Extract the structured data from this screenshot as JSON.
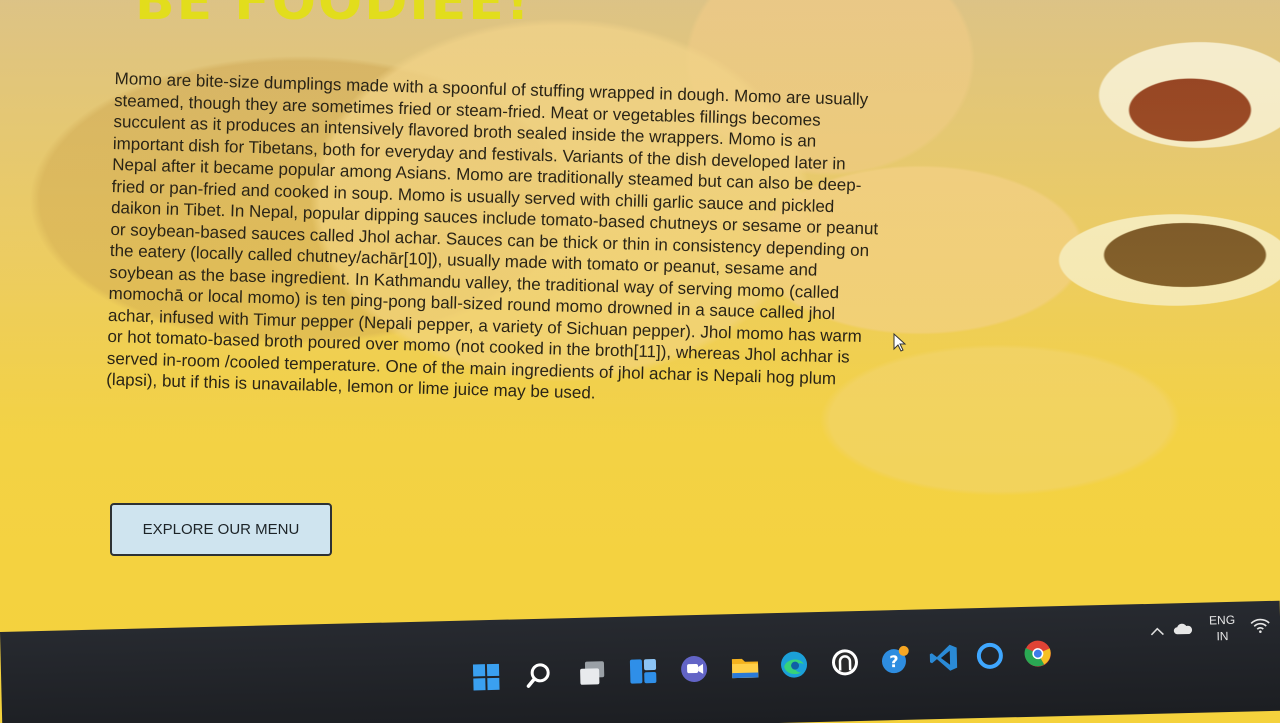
{
  "hero": {
    "title": "BE FOODIEE!",
    "description": "Momo are bite-size dumplings made with a spoonful of stuffing wrapped in dough. Momo are usually steamed, though they are sometimes fried or steam-fried. Meat or vegetables fillings becomes succulent as it produces an intensively flavored broth sealed inside the wrappers. Momo is an important dish for Tibetans, both for everyday and festivals. Variants of the dish developed later in Nepal after it became popular among Asians. Momo are traditionally steamed but can also be deep-fried or pan-fried and cooked in soup. Momo is usually served with chilli garlic sauce and pickled daikon in Tibet. In Nepal, popular dipping sauces include tomato-based chutneys or sesame or peanut or soybean-based sauces called Jhol achar. Sauces can be thick or thin in consistency depending on the eatery (locally called chutney/achār[10]), usually made with tomato or peanut, sesame and soybean as the base ingredient. In Kathmandu valley, the traditional way of serving momo (called momochā or local momo) is ten ping-pong ball-sized round momo drowned in a sauce called jhol achar, infused with Timur pepper (Nepali pepper, a variety of Sichuan pepper). Jhol momo has warm or hot tomato-based broth poured over momo (not cooked in the broth[11]), whereas Jhol achhar is served in-room /cooled temperature. One of the main ingredients of jhol achar is Nepali hog plum (lapsi), but if this is unavailable, lemon or lime juice may be used.",
    "button_label": "EXPLORE OUR MENU"
  },
  "social": [
    {
      "icon": "facebook-icon"
    },
    {
      "icon": "instagram-icon"
    },
    {
      "icon": "twitter-icon"
    }
  ],
  "taskbar": {
    "icons": [
      "windows-start-icon",
      "search-icon",
      "task-view-icon",
      "widgets-icon",
      "chat-icon",
      "file-explorer-icon",
      "edge-icon",
      "app-icon",
      "help-icon",
      "vscode-icon",
      "cortana-icon",
      "chrome-icon"
    ],
    "tray": {
      "language": "ENG",
      "region": "IN"
    }
  },
  "colors": {
    "title": "#e2dd1c",
    "button_bg": "#cfe4ef",
    "overlay": "#f3cd3c",
    "taskbar": "#202226"
  }
}
